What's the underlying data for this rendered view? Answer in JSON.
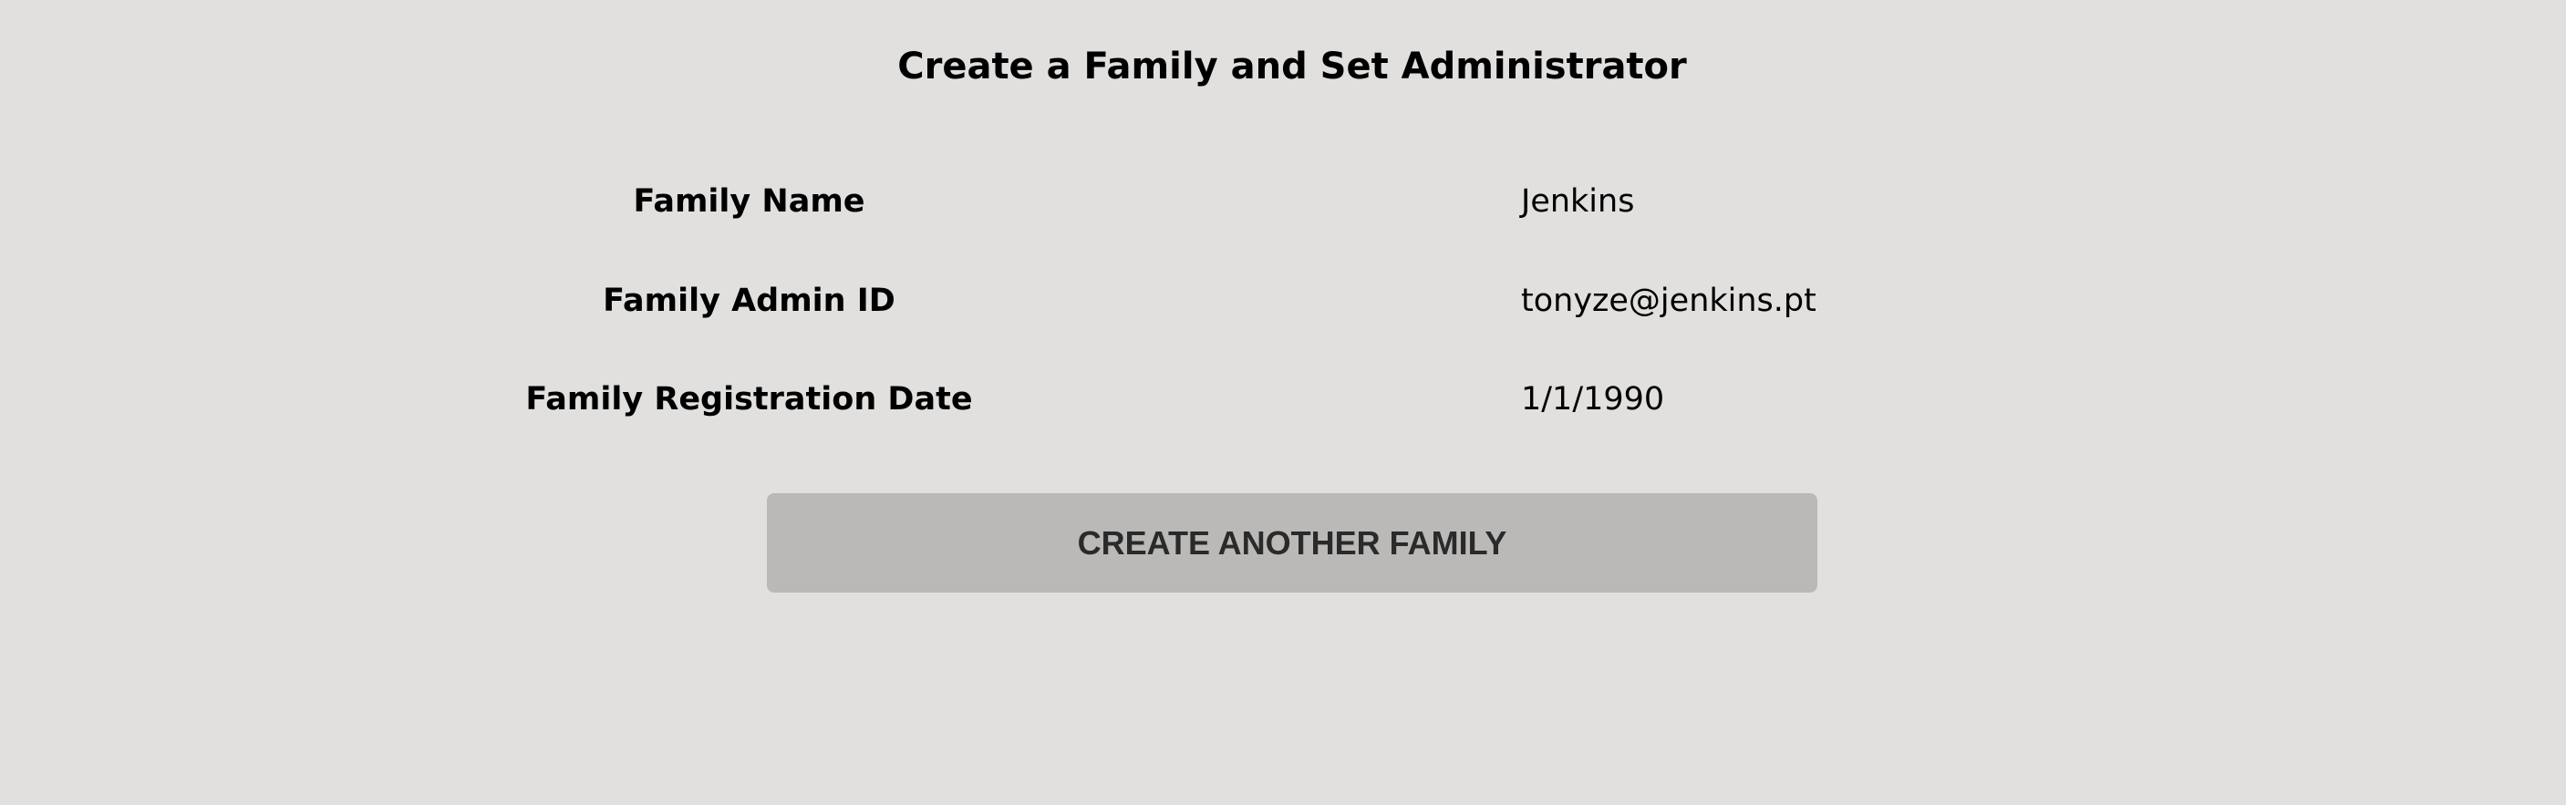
{
  "page": {
    "title": "Create a Family and Set Administrator"
  },
  "fields": [
    {
      "label": "Family Name",
      "value": "Jenkins"
    },
    {
      "label": "Family Admin ID",
      "value": "tonyze@jenkins.pt"
    },
    {
      "label": "Family Registration Date",
      "value": "1/1/1990"
    }
  ],
  "actions": {
    "create_another_label": "CREATE ANOTHER FAMILY"
  },
  "colors": {
    "background": "#e1e0df",
    "button_background": "#bab9b8",
    "button_text": "#2a2a2a"
  }
}
